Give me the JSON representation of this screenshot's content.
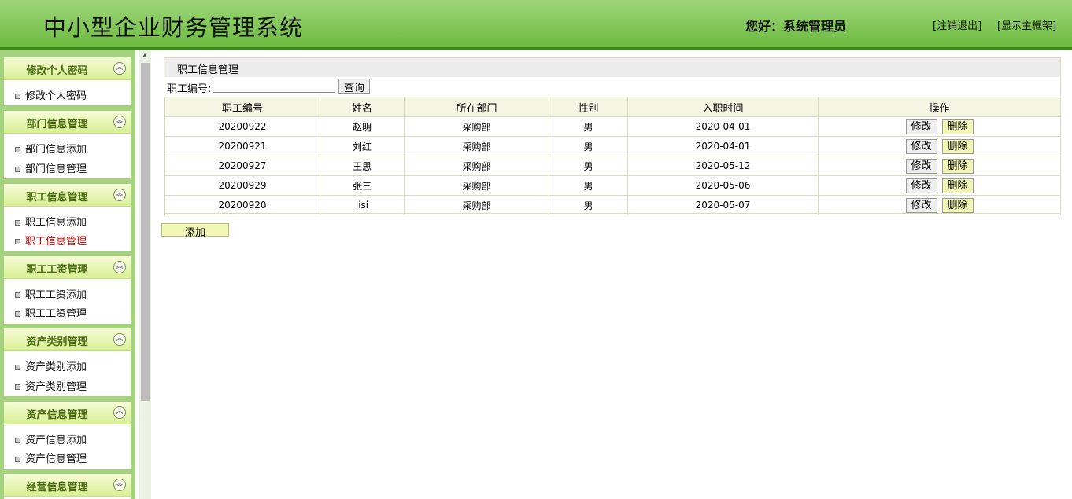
{
  "header": {
    "app_title": "中小型企业财务管理系统",
    "greeting": "您好：系统管理员",
    "logout": "[注销退出]",
    "show_frame": "[显示主框架]"
  },
  "sidebar": {
    "panels": [
      {
        "title": "修改个人密码",
        "items": [
          "修改个人密码"
        ]
      },
      {
        "title": "部门信息管理",
        "items": [
          "部门信息添加",
          "部门信息管理"
        ]
      },
      {
        "title": "职工信息管理",
        "items": [
          "职工信息添加",
          "职工信息管理"
        ],
        "active_item": "职工信息管理"
      },
      {
        "title": "职工工资管理",
        "items": [
          "职工工资添加",
          "职工工资管理"
        ]
      },
      {
        "title": "资产类别管理",
        "items": [
          "资产类别添加",
          "资产类别管理"
        ]
      },
      {
        "title": "资产信息管理",
        "items": [
          "资产信息添加",
          "资产信息管理"
        ]
      },
      {
        "title": "经营信息管理",
        "items": []
      }
    ]
  },
  "content": {
    "box_title": "职工信息管理",
    "search_label": "职工编号:",
    "search_value": "",
    "search_button": "查询",
    "columns": [
      "职工编号",
      "姓名",
      "所在部门",
      "性别",
      "入职时间",
      "操作"
    ],
    "rows": [
      [
        "20200922",
        "赵明",
        "采购部",
        "男",
        "2020-04-01"
      ],
      [
        "20200921",
        "刘红",
        "采购部",
        "男",
        "2020-04-01"
      ],
      [
        "20200927",
        "王思",
        "采购部",
        "男",
        "2020-05-12"
      ],
      [
        "20200929",
        "张三",
        "采购部",
        "男",
        "2020-05-06"
      ],
      [
        "20200920",
        "lisi",
        "采购部",
        "男",
        "2020-05-07"
      ]
    ],
    "edit_label": "修改",
    "delete_label": "删除",
    "add_button": "添加"
  },
  "colors": {
    "header_green": "#6cbb3f",
    "sidebar_green": "#a4d27f",
    "panel_title": "#4a6a10",
    "active_menu": "#d40000",
    "delete_button_bg": "#f3f7b6"
  }
}
